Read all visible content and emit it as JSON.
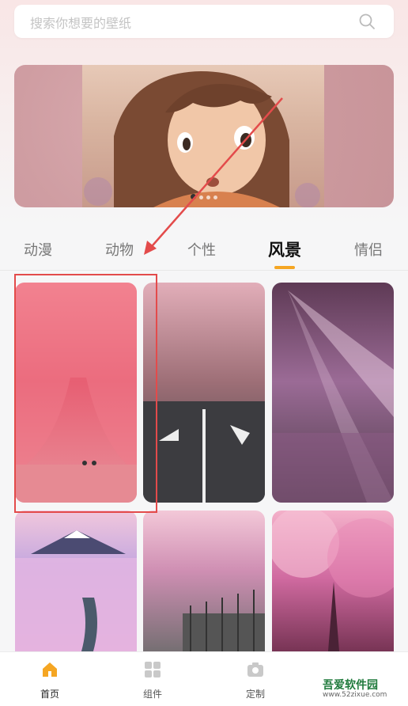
{
  "search": {
    "placeholder": "搜索你想要的壁纸"
  },
  "banner": {
    "active_dot_index": 0,
    "dot_count": 4
  },
  "tabs": [
    {
      "label": "动漫"
    },
    {
      "label": "动物"
    },
    {
      "label": "个性"
    },
    {
      "label": "风景",
      "active": true
    },
    {
      "label": "情侣"
    }
  ],
  "wallpapers": [
    {
      "subject": "pink-cherry-tree-avenue"
    },
    {
      "subject": "cherry-blossom-street"
    },
    {
      "subject": "sunrays-through-blossoms"
    },
    {
      "subject": "mount-fuji-pink-forest"
    },
    {
      "subject": "pink-palms-by-fence"
    },
    {
      "subject": "pink-tree-canopy"
    }
  ],
  "bottom_nav": [
    {
      "label": "首页",
      "icon": "home-icon",
      "active": true
    },
    {
      "label": "组件",
      "icon": "grid-icon"
    },
    {
      "label": "定制",
      "icon": "camera-icon"
    }
  ],
  "watermark": {
    "title": "吾爱软件园",
    "url": "www.52zixue.com"
  },
  "colors": {
    "accent": "#f5a623",
    "highlight": "#e34b4b"
  }
}
